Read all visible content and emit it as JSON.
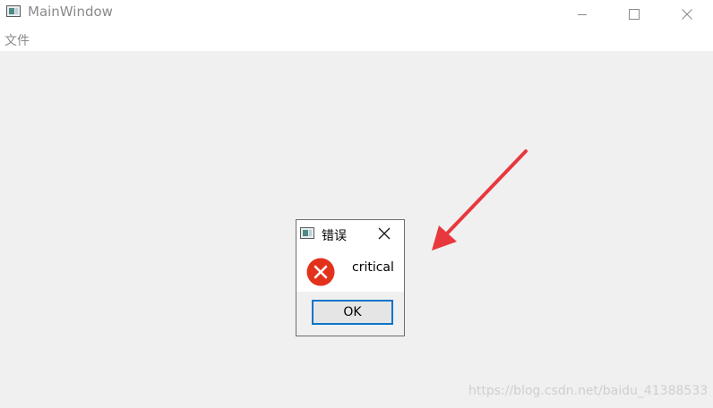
{
  "window": {
    "title": "MainWindow",
    "icon": "app-window-icon",
    "controls": {
      "minimize": "minimize-icon",
      "maximize": "maximize-icon",
      "close": "close-icon"
    }
  },
  "menubar": {
    "items": [
      {
        "label": "文件"
      }
    ]
  },
  "dialog": {
    "title": "错误",
    "icon": "critical-error-icon",
    "message": "critical",
    "ok_label": "OK",
    "accent_color": "#0a75c8",
    "error_color": "#e2321c"
  },
  "annotation": {
    "arrow_color": "#e8383d"
  },
  "watermark": "https://blog.csdn.net/baidu_41388533"
}
